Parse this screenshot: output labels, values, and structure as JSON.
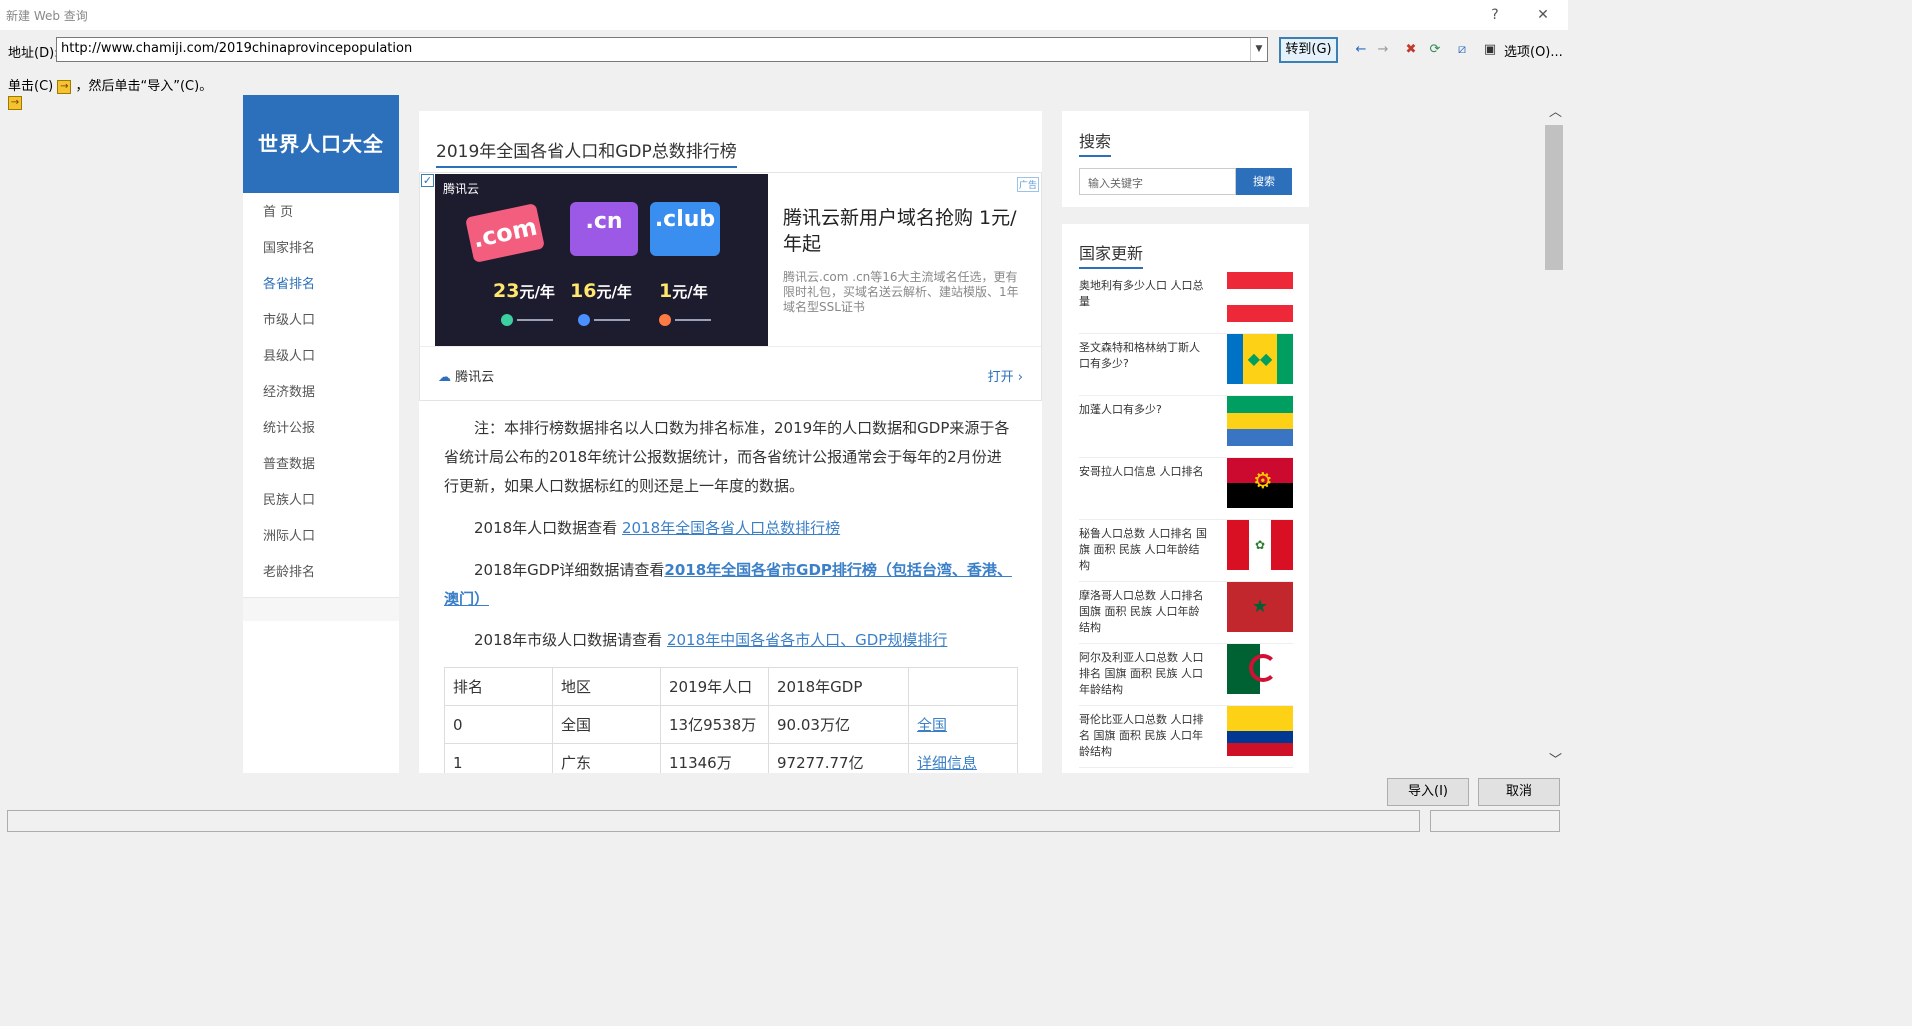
{
  "window": {
    "title": "新建 Web 查询",
    "help": "?",
    "close": "✕"
  },
  "address": {
    "label": "地址(D):",
    "url": "http://www.chamiji.com/2019chinaprovincepopulation",
    "goto": "转到(G)",
    "options": "选项(O)..."
  },
  "instruction": {
    "prefix": "单击(C)",
    "suffix": "，然后单击“导入”(C)。"
  },
  "site": {
    "logo": "世界人口大全",
    "nav": [
      "首 页",
      "国家排名",
      "各省排名",
      "市级人口",
      "县级人口",
      "经济数据",
      "统计公报",
      "普查数据",
      "民族人口",
      "洲际人口",
      "老龄排名"
    ],
    "active_nav": "各省排名"
  },
  "article": {
    "title": "2019年全国各省人口和GDP总数排行榜",
    "ad": {
      "brand": "腾讯云",
      "cards": [
        ".com",
        ".cn",
        ".club"
      ],
      "prices": [
        {
          "num": "23",
          "unit": "元/年"
        },
        {
          "num": "16",
          "unit": "元/年"
        },
        {
          "num": "1",
          "unit": "元/年"
        }
      ],
      "tag": "广告",
      "headline": "腾讯云新用户域名抢购 1元/年起",
      "desc": "腾讯云.com .cn等16大主流域名任选，更有限时礼包，买域名送云解析、建站模版、1年域名型SSL证书",
      "footer_brand": "腾讯云",
      "open": "打开 ›"
    },
    "note": "注：本排行榜数据排名以人口数为排名标准，2019年的人口数据和GDP来源于各省统计局公布的2018年统计公报数据统计，而各省统计公报通常会于每年的2月份进行更新，如果人口数据标红的则还是上一年度的数据。",
    "p1_prefix": "2018年人口数据查看 ",
    "p1_link": "2018年全国各省人口总数排行榜",
    "p2_prefix": "2018年GDP详细数据请查看",
    "p2_link": "2018年全国各省市GDP排行榜（包括台湾、香港、澳门）",
    "p3_prefix": "2018年市级人口数据请查看 ",
    "p3_link": "2018年中国各省各市人口、GDP规模排行",
    "table": {
      "headers": [
        "排名",
        "地区",
        "2019年人口",
        "2018年GDP",
        ""
      ],
      "rows": [
        [
          "0",
          "全国",
          "13亿9538万",
          "90.03万亿",
          "全国"
        ],
        [
          "1",
          "广东",
          "11346万",
          "97277.77亿",
          "详细信息"
        ]
      ]
    }
  },
  "sidebar": {
    "search_title": "搜索",
    "search_placeholder": "输入关键字",
    "search_btn": "搜索",
    "updates_title": "国家更新",
    "countries": [
      "奥地利有多少人口 人口总量",
      "圣文森特和格林纳丁斯人口有多少?",
      "加蓬人口有多少?",
      "安哥拉人口信息 人口排名",
      "秘鲁人口总数 人口排名 国旗 面积 民族 人口年龄结构",
      "摩洛哥人口总数 人口排名 国旗 面积 民族 人口年龄结构",
      "阿尔及利亚人口总数 人口排名 国旗 面积 民族 人口年龄结构",
      "哥伦比亚人口总数 人口排名 国旗 面积 民族 人口年龄结构"
    ]
  },
  "footer": {
    "import": "导入(I)",
    "cancel": "取消"
  },
  "colors": {
    "accent": "#2c6fba",
    "link": "#3a7fc8"
  }
}
